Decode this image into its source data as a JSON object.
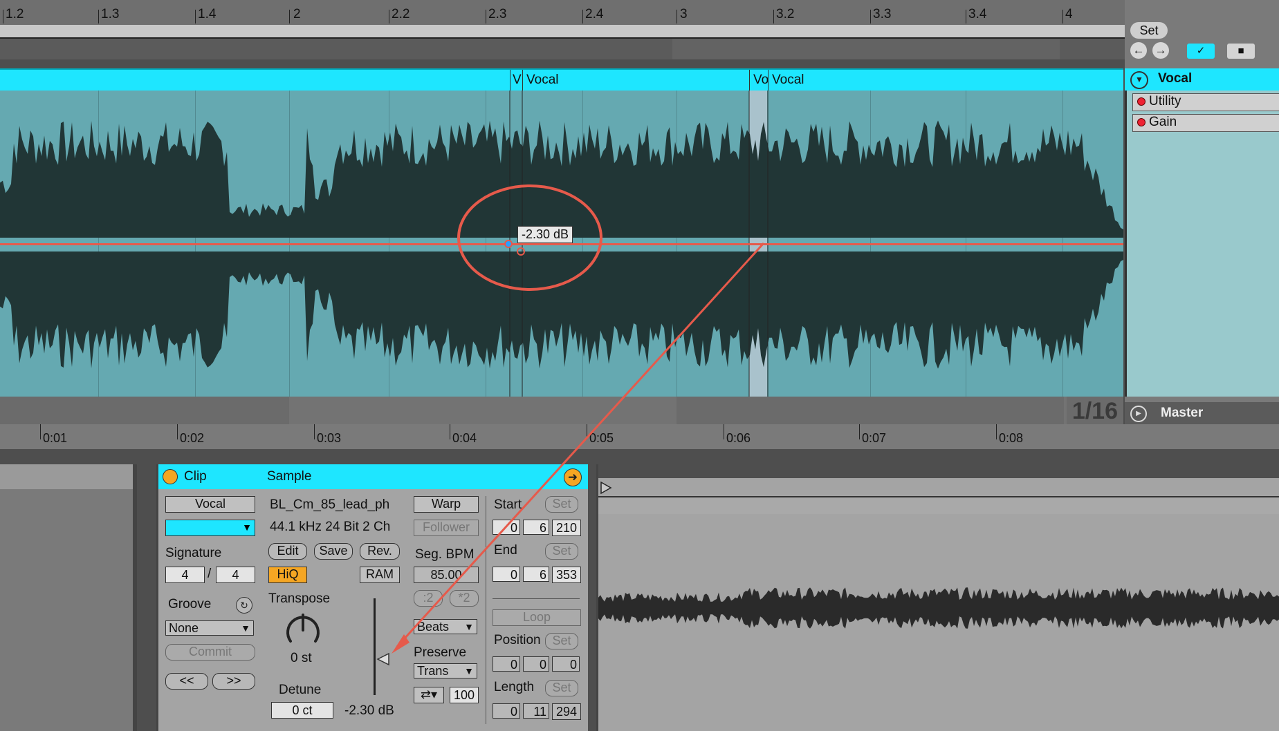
{
  "arrangement": {
    "bar_labels": [
      {
        "text": "1.2"
      },
      {
        "text": "1.3"
      },
      {
        "text": "1.4"
      },
      {
        "text": "2"
      },
      {
        "text": "2.2"
      },
      {
        "text": "2.3"
      },
      {
        "text": "2.4"
      },
      {
        "text": "3"
      },
      {
        "text": "3.2"
      },
      {
        "text": "3.3"
      },
      {
        "text": "3.4"
      },
      {
        "text": "4"
      }
    ],
    "clip_names": [
      "V",
      "Vocal",
      "Vo",
      "Vocal"
    ],
    "envelope_tooltip": "-2.30 dB",
    "grid_quantize": "1/16",
    "time_labels": [
      "0:01",
      "0:02",
      "0:03",
      "0:04",
      "0:05",
      "0:06",
      "0:07",
      "0:08"
    ]
  },
  "right_panel": {
    "set_label": "Set",
    "track_name": "Vocal",
    "chain": [
      "Utility",
      "Gain"
    ],
    "master_label": "Master"
  },
  "clip_view": {
    "title": "Clip",
    "clip_name": "Vocal",
    "signature_label": "Signature",
    "sig_num": "4",
    "sig_slash": "/",
    "sig_den": "4",
    "groove_label": "Groove",
    "groove_value": "None",
    "commit_label": "Commit",
    "prev_label": "<<",
    "next_label": ">>"
  },
  "sample_view": {
    "title": "Sample",
    "filename": "BL_Cm_85_lead_ph",
    "format": "44.1 kHz 24 Bit 2 Ch",
    "edit_label": "Edit",
    "save_label": "Save",
    "rev_label": "Rev.",
    "hiq_label": "HiQ",
    "ram_label": "RAM",
    "transpose_label": "Transpose",
    "transpose_value": "0 st",
    "detune_label": "Detune",
    "detune_value": "0 ct",
    "gain_value": "-2.30 dB",
    "warp_label": "Warp",
    "follower_label": "Follower",
    "seg_bpm_label": "Seg. BPM",
    "seg_bpm_value": "85.00",
    "half_label": ":2",
    "double_label": "*2",
    "warp_mode": "Beats",
    "preserve_label": "Preserve",
    "preserve_value": "Trans",
    "loop_mode_value": "100",
    "start_label": "Start",
    "start_values": [
      "0",
      "6",
      "210"
    ],
    "end_label": "End",
    "end_values": [
      "0",
      "6",
      "353"
    ],
    "loop_label": "Loop",
    "position_label": "Position",
    "position_values": [
      "0",
      "0",
      "0"
    ],
    "length_label": "Length",
    "length_values": [
      "0",
      "11",
      "294"
    ],
    "set_label": "Set"
  },
  "colors": {
    "accent_cyan": "#1ee6ff",
    "waveform_bg": "#65a9b1",
    "envelope_red": "#e65a4b",
    "hiq_orange": "#f5a623"
  }
}
